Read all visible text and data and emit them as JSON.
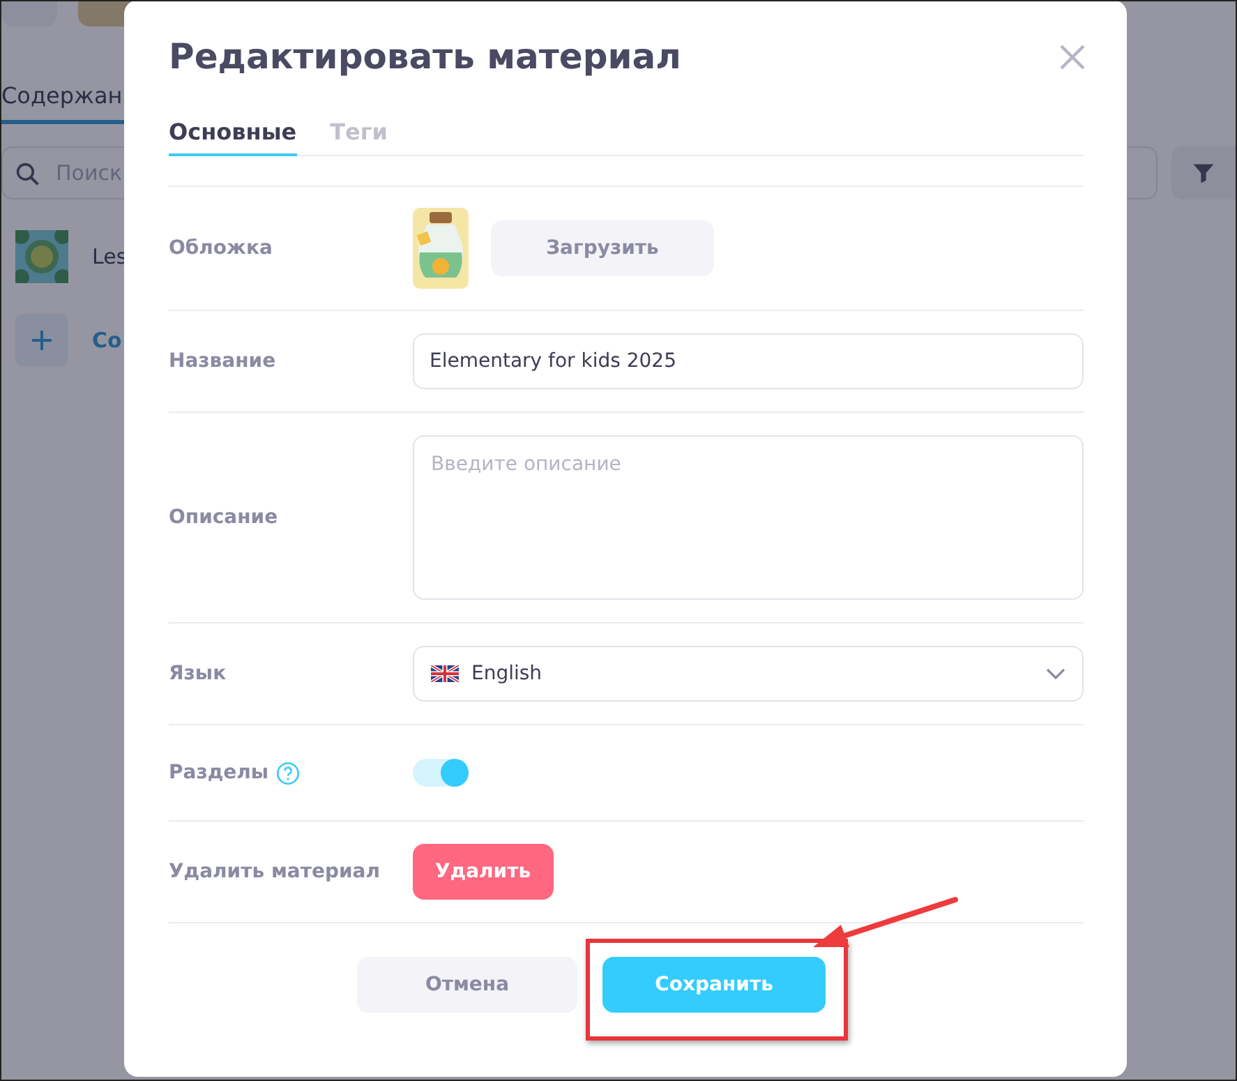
{
  "background": {
    "tab": "Содержан",
    "search_placeholder": "Поиск",
    "items": [
      {
        "kind": "lesson",
        "label": "Les"
      },
      {
        "kind": "create",
        "label": "Со"
      }
    ]
  },
  "dialog": {
    "title": "Редактировать материал",
    "tabs": [
      {
        "label": "Основные",
        "selected": true
      },
      {
        "label": "Теги",
        "selected": false
      }
    ],
    "fields": [
      {
        "kind": "cover",
        "label": "Обложка",
        "button": "Загрузить"
      },
      {
        "kind": "text",
        "label": "Название",
        "value": "Elementary for kids 2025"
      },
      {
        "kind": "textarea",
        "label": "Описание",
        "placeholder": "Введите описание"
      },
      {
        "kind": "select",
        "label": "Язык",
        "value": "English"
      },
      {
        "kind": "toggle",
        "label": "Разделы",
        "on": true
      },
      {
        "kind": "danger",
        "label": "Удалить материал",
        "button": "Удалить"
      }
    ],
    "buttons": [
      {
        "kind": "secondary",
        "label": "Отмена",
        "highlighted": false
      },
      {
        "kind": "primary",
        "label": "Сохранить",
        "highlighted": true
      }
    ]
  }
}
